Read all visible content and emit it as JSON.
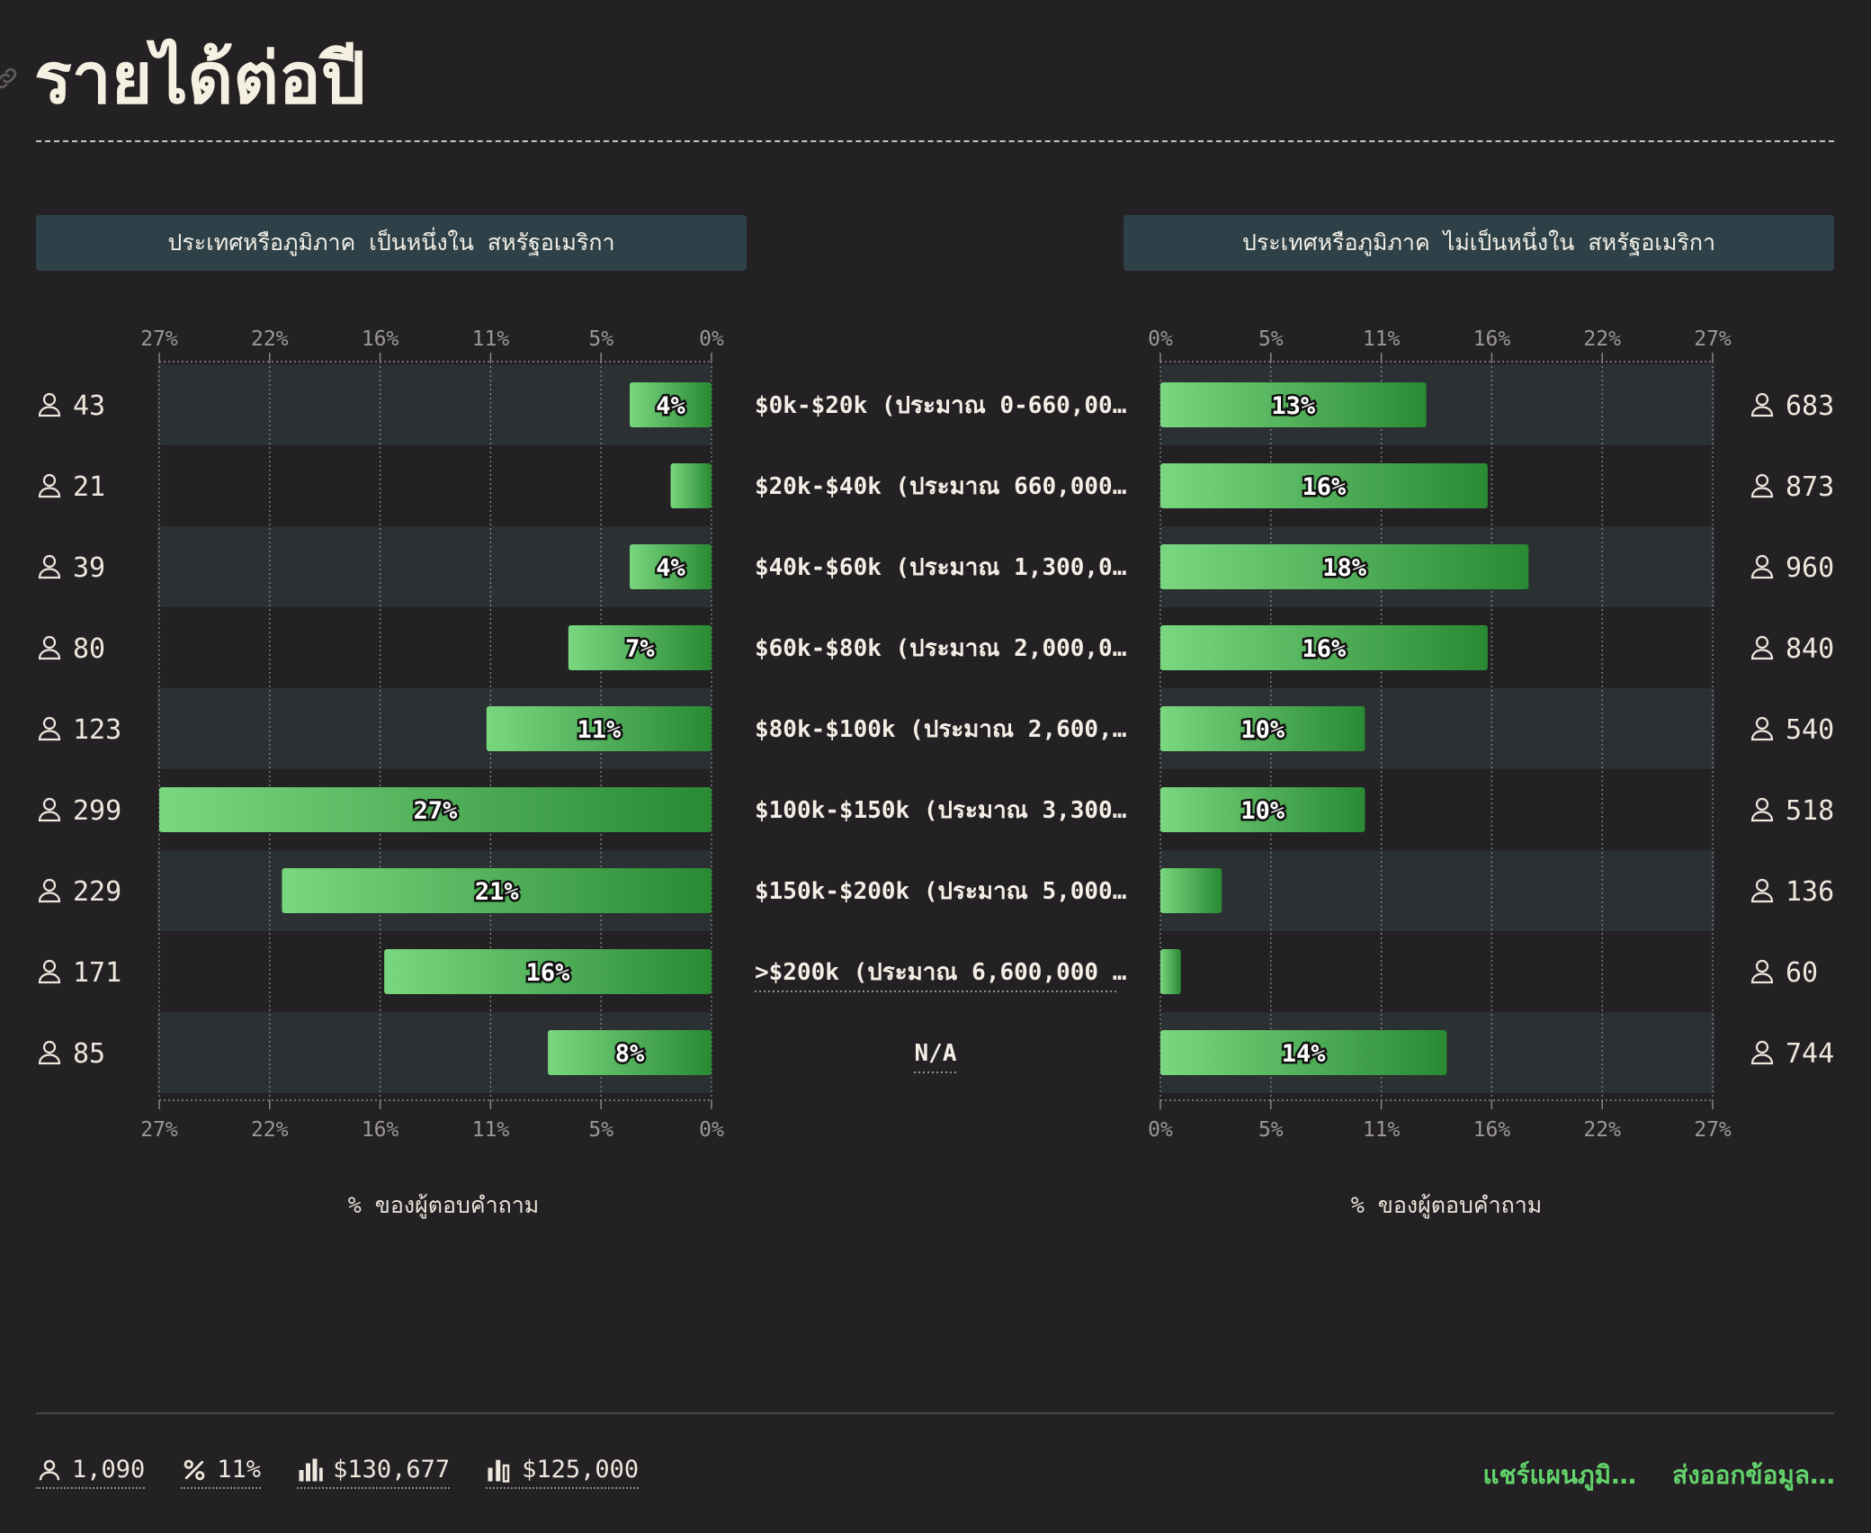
{
  "title": "รายได้ต่อปี",
  "left_panel": {
    "header": "ประเทศหรือภูมิภาค เป็นหนึ่งใน สหรัฐอเมริกา",
    "axis_label": "% ของผู้ตอบคำถาม"
  },
  "right_panel": {
    "header": "ประเทศหรือภูมิภาค ไม่เป็นหนึ่งใน สหรัฐอเมริกา",
    "axis_label": "% ของผู้ตอบคำถาม"
  },
  "chart_data": {
    "type": "bar",
    "orientation": "horizontal-butterfly",
    "categories": [
      "$0k-$20k (ประมาณ 0-660,00…",
      "$20k-$40k (ประมาณ 660,000…",
      "$40k-$60k (ประมาณ 1,300,0…",
      "$60k-$80k (ประมาณ 2,000,0…",
      "$80k-$100k (ประมาณ 2,600,…",
      "$100k-$150k (ประมาณ 3,300…",
      "$150k-$200k (ประมาณ 5,000…",
      ">$200k (ประมาณ 6,600,000 …",
      "N/A"
    ],
    "x_ticks": [
      "0%",
      "5%",
      "11%",
      "16%",
      "22%",
      "27%"
    ],
    "xlim": [
      0,
      27
    ],
    "series": [
      {
        "name": "ประเทศหรือภูมิภาค เป็นหนึ่งใน สหรัฐอเมริกา",
        "values": [
          4,
          2,
          4,
          7,
          11,
          27,
          21,
          16,
          8
        ],
        "labels": [
          "4%",
          "",
          "4%",
          "7%",
          "11%",
          "27%",
          "21%",
          "16%",
          "8%"
        ],
        "counts": [
          "43",
          "21",
          "39",
          "80",
          "123",
          "299",
          "229",
          "171",
          "85"
        ]
      },
      {
        "name": "ประเทศหรือภูมิภาค ไม่เป็นหนึ่งใน สหรัฐอเมริกา",
        "values": [
          13,
          16,
          18,
          16,
          10,
          10,
          3,
          1,
          14
        ],
        "labels": [
          "13%",
          "16%",
          "18%",
          "16%",
          "10%",
          "10%",
          "",
          "",
          "14%"
        ],
        "counts": [
          "683",
          "873",
          "960",
          "840",
          "540",
          "518",
          "136",
          "60",
          "744"
        ]
      }
    ],
    "colors": {
      "bar_start": "#79d77f",
      "bar_end": "#2a8a34",
      "row_band": "#2b3033",
      "background": "#232123"
    }
  },
  "footer": {
    "stats": [
      {
        "icon": "person-icon",
        "value": "1,090"
      },
      {
        "icon": "percent-icon",
        "value": "11%"
      },
      {
        "icon": "mean-bar-icon",
        "value": "$130,677"
      },
      {
        "icon": "median-bar-icon",
        "value": "$125,000"
      }
    ],
    "actions": {
      "share": "แชร์แผนภูมิ…",
      "export": "ส่งออกข้อมูล…"
    }
  }
}
